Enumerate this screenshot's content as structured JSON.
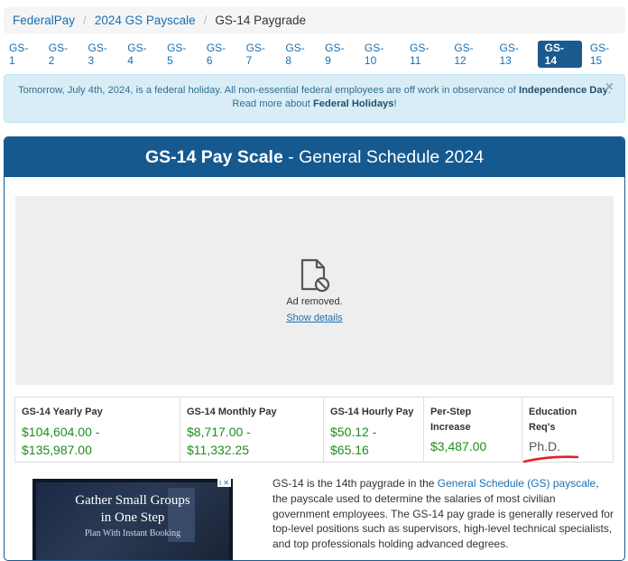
{
  "breadcrumb": {
    "items": [
      "FederalPay",
      "2024 GS Payscale"
    ],
    "current": "GS-14 Paygrade"
  },
  "tabs": [
    "GS-1",
    "GS-2",
    "GS-3",
    "GS-4",
    "GS-5",
    "GS-6",
    "GS-7",
    "GS-8",
    "GS-9",
    "GS-10",
    "GS-11",
    "GS-12",
    "GS-13",
    "GS-14",
    "GS-15"
  ],
  "active_tab": "GS-14",
  "alert": {
    "line1_pre": "Tomorrow, July 4th, 2024, is a federal holiday. All non-essential federal employees are off work in observance of ",
    "line1_bold": "Independence Day",
    "line1_post": ".",
    "line2_pre": "Read more about ",
    "line2_bold": "Federal Holidays",
    "line2_post": "!",
    "close": "×"
  },
  "panel": {
    "title_bold": "GS-14 Pay Scale",
    "title_rest": " - General Schedule 2024"
  },
  "ad_removed": {
    "text": "Ad removed.",
    "link": "Show details"
  },
  "stats": [
    {
      "label": "GS-14 Yearly Pay",
      "value_line1": "$104,604.00 -",
      "value_line2": "$135,987.00"
    },
    {
      "label": "GS-14 Monthly Pay",
      "value_line1": "$8,717.00 -",
      "value_line2": "$11,332.25"
    },
    {
      "label": "GS-14 Hourly Pay",
      "value_line1": "$50.12 -",
      "value_line2": "$65.16"
    },
    {
      "label_line1": "Per-Step",
      "label_line2": "Increase",
      "value": "$3,487.00"
    },
    {
      "label_line1": "Education",
      "label_line2": "Req's",
      "value": "Ph.D."
    }
  ],
  "ad_banner": {
    "line1": "Gather Small Groups",
    "line2": "in One Step",
    "line3": "Plan With Instant Booking",
    "badge": "i ✕"
  },
  "description": {
    "p1": "GS-14 is the 14th paygrade in the ",
    "link": "General Schedule (GS) payscale",
    "p2": ", the payscale used to determine the salaries of most civilian government employees. The GS-14 pay grade is generally reserved for top-level positions such as supervisors, high-level technical specialists, and top professionals holding advanced degrees."
  },
  "colors": {
    "brand": "#15598f",
    "link": "#1a6fb0",
    "pay_green": "#1e8e1e",
    "annotation_red": "#e0202a"
  }
}
